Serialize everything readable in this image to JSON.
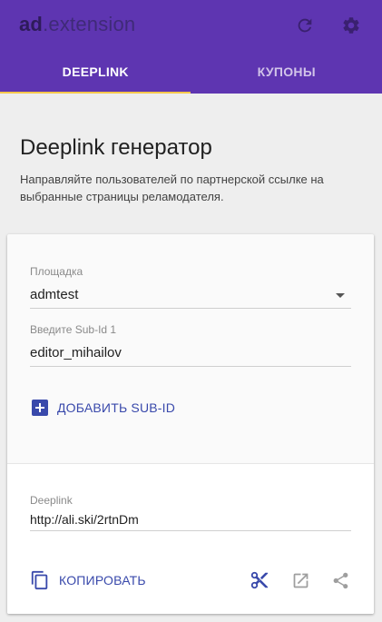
{
  "app": {
    "brand_strong": "ad",
    "brand_rest": ".extension"
  },
  "tabs": [
    {
      "label": "DEEPLINK",
      "active": true
    },
    {
      "label": "КУПОНЫ",
      "active": false
    }
  ],
  "page": {
    "title": "Deeplink генератор",
    "description": "Направляйте пользователей по партнерской ссылке на выбранные страницы реламодателя."
  },
  "form": {
    "platform_label": "Площадка",
    "platform_value": "admtest",
    "subid_label": "Введите Sub-Id 1",
    "subid_value": "editor_mihailov",
    "add_subid_label": "ДОБАВИТЬ SUB-ID"
  },
  "result": {
    "deeplink_label": "Deeplink",
    "deeplink_value": "http://ali.ski/2rtnDm",
    "copy_label": "КОПИРОВАТЬ"
  },
  "icons": {
    "refresh": "refresh-icon",
    "settings": "gear-icon",
    "add": "plus-box-icon",
    "copy": "copy-icon",
    "cut": "scissors-icon",
    "open": "open-in-new-icon",
    "share": "share-icon"
  },
  "colors": {
    "primary": "#5e35b1",
    "accent": "#3949ab",
    "tab_indicator": "#f5c74b"
  }
}
